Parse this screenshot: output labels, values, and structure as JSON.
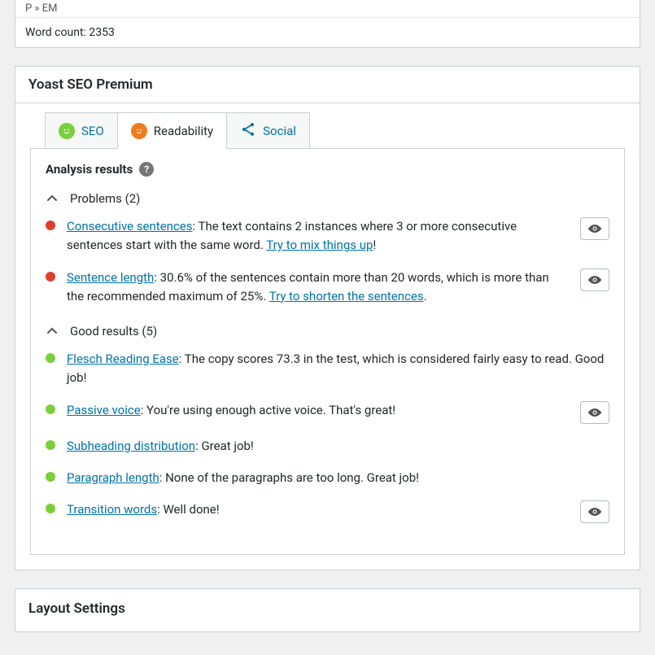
{
  "editor": {
    "path": "P » EM",
    "wordcount_label": "Word count: 2353"
  },
  "panel": {
    "title": "Yoast SEO Premium"
  },
  "tabs": {
    "seo": "SEO",
    "readability": "Readability",
    "social": "Social"
  },
  "analysis": {
    "heading": "Analysis results",
    "problems_label": "Problems (2)",
    "good_label": "Good results (5)",
    "problems": [
      {
        "link": "Consecutive sentences",
        "text_after_link": ": The text contains 2 instances where 3 or more consecutive sentences start with the same word. ",
        "action_link": "Try to mix things up",
        "tail": "!",
        "has_eye": true
      },
      {
        "link": "Sentence length",
        "text_after_link": ": 30.6% of the sentences contain more than 20 words, which is more than the recommended maximum of 25%. ",
        "action_link": "Try to shorten the sentences",
        "tail": ".",
        "has_eye": true
      }
    ],
    "good": [
      {
        "link": "Flesch Reading Ease",
        "text_after_link": ": The copy scores 73.3 in the test, which is considered fairly easy to read. Good job!",
        "has_eye": false
      },
      {
        "link": "Passive voice",
        "text_after_link": ": You're using enough active voice. That's great!",
        "has_eye": true
      },
      {
        "link": "Subheading distribution",
        "text_after_link": ": Great job!",
        "has_eye": false
      },
      {
        "link": "Paragraph length",
        "text_after_link": ": None of the paragraphs are too long. Great job!",
        "has_eye": false
      },
      {
        "link": "Transition words",
        "text_after_link": ": Well done!",
        "has_eye": true
      }
    ]
  },
  "layout_panel": {
    "title": "Layout Settings"
  },
  "colors": {
    "green": "#7ad03a",
    "orange": "#ee7c1b",
    "red": "#e03e2d",
    "link": "#0073aa"
  }
}
